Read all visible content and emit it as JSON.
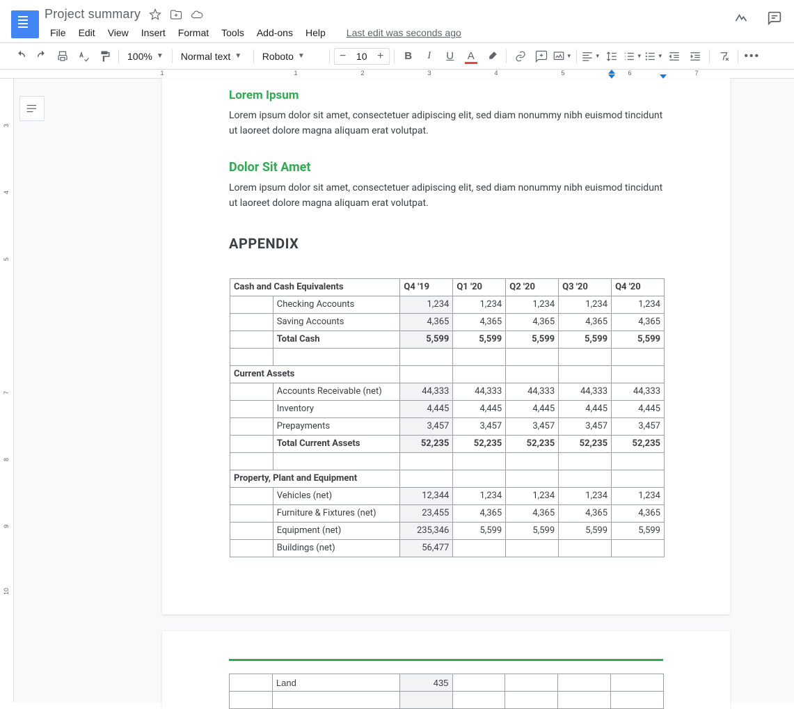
{
  "header": {
    "title": "Project summary",
    "last_edit": "Last edit was seconds ago"
  },
  "menus": [
    "File",
    "Edit",
    "View",
    "Insert",
    "Format",
    "Tools",
    "Add-ons",
    "Help"
  ],
  "toolbar": {
    "zoom": "100%",
    "style": "Normal text",
    "font": "Roboto",
    "font_size": "10"
  },
  "ruler": {
    "hticks": [
      "1",
      "1",
      "2",
      "3",
      "4",
      "5",
      "6",
      "7"
    ],
    "vticks": [
      "3",
      "4",
      "5",
      "7",
      "8",
      "9",
      "10"
    ]
  },
  "content": {
    "h1": "Lorem Ipsum",
    "p1": "Lorem ipsum dolor sit amet, consectetuer adipiscing elit, sed diam nonummy nibh euismod tincidunt ut laoreet dolore magna aliquam erat volutpat.",
    "h2": "Dolor Sit Amet",
    "p2": "Lorem ipsum dolor sit amet, consectetuer adipiscing elit, sed diam nonummy nibh euismod tincidunt ut laoreet dolore magna aliquam erat volutpat.",
    "appendix": "APPENDIX"
  },
  "table": {
    "columns": [
      "Q4 '19",
      "Q1 '20",
      "Q2 '20",
      "Q3 '20",
      "Q4 '20"
    ],
    "sections": [
      {
        "head": "Cash and Cash Equivalents",
        "rows": [
          {
            "label": "Checking Accounts",
            "vals": [
              "1,234",
              "1,234",
              "1,234",
              "1,234",
              "1,234"
            ]
          },
          {
            "label": "Saving Accounts",
            "vals": [
              "4,365",
              "4,365",
              "4,365",
              "4,365",
              "4,365"
            ]
          },
          {
            "label": "Total Cash",
            "bold": true,
            "vals": [
              "5,599",
              "5,599",
              "5,599",
              "5,599",
              "5,599"
            ]
          }
        ],
        "spacer": true
      },
      {
        "head": "Current Assets",
        "rows": [
          {
            "label": "Accounts Receivable (net)",
            "vals": [
              "44,333",
              "44,333",
              "44,333",
              "44,333",
              "44,333"
            ]
          },
          {
            "label": "Inventory",
            "vals": [
              "4,445",
              "4,445",
              "4,445",
              "4,445",
              "4,445"
            ]
          },
          {
            "label": "Prepayments",
            "vals": [
              "3,457",
              "3,457",
              "3,457",
              "3,457",
              "3,457"
            ]
          },
          {
            "label": "Total Current Assets",
            "bold": true,
            "vals": [
              "52,235",
              "52,235",
              "52,235",
              "52,235",
              "52,235"
            ]
          }
        ],
        "spacer": true
      },
      {
        "head": "Property, Plant and Equipment",
        "rows": [
          {
            "label": "Vehicles (net)",
            "vals": [
              "12,344",
              "1,234",
              "1,234",
              "1,234",
              "1,234"
            ]
          },
          {
            "label": "Furniture & Fixtures (net)",
            "vals": [
              "23,455",
              "4,365",
              "4,365",
              "4,365",
              "4,365"
            ]
          },
          {
            "label": "Equipment (net)",
            "vals": [
              "235,346",
              "5,599",
              "5,599",
              "5,599",
              "5,599"
            ]
          },
          {
            "label": "Buildings (net)",
            "vals": [
              "56,477",
              "",
              "",
              "",
              ""
            ]
          }
        ]
      }
    ]
  },
  "table2": {
    "rows": [
      {
        "label": "Land",
        "vals": [
          "435",
          "",
          "",
          "",
          ""
        ]
      }
    ]
  }
}
